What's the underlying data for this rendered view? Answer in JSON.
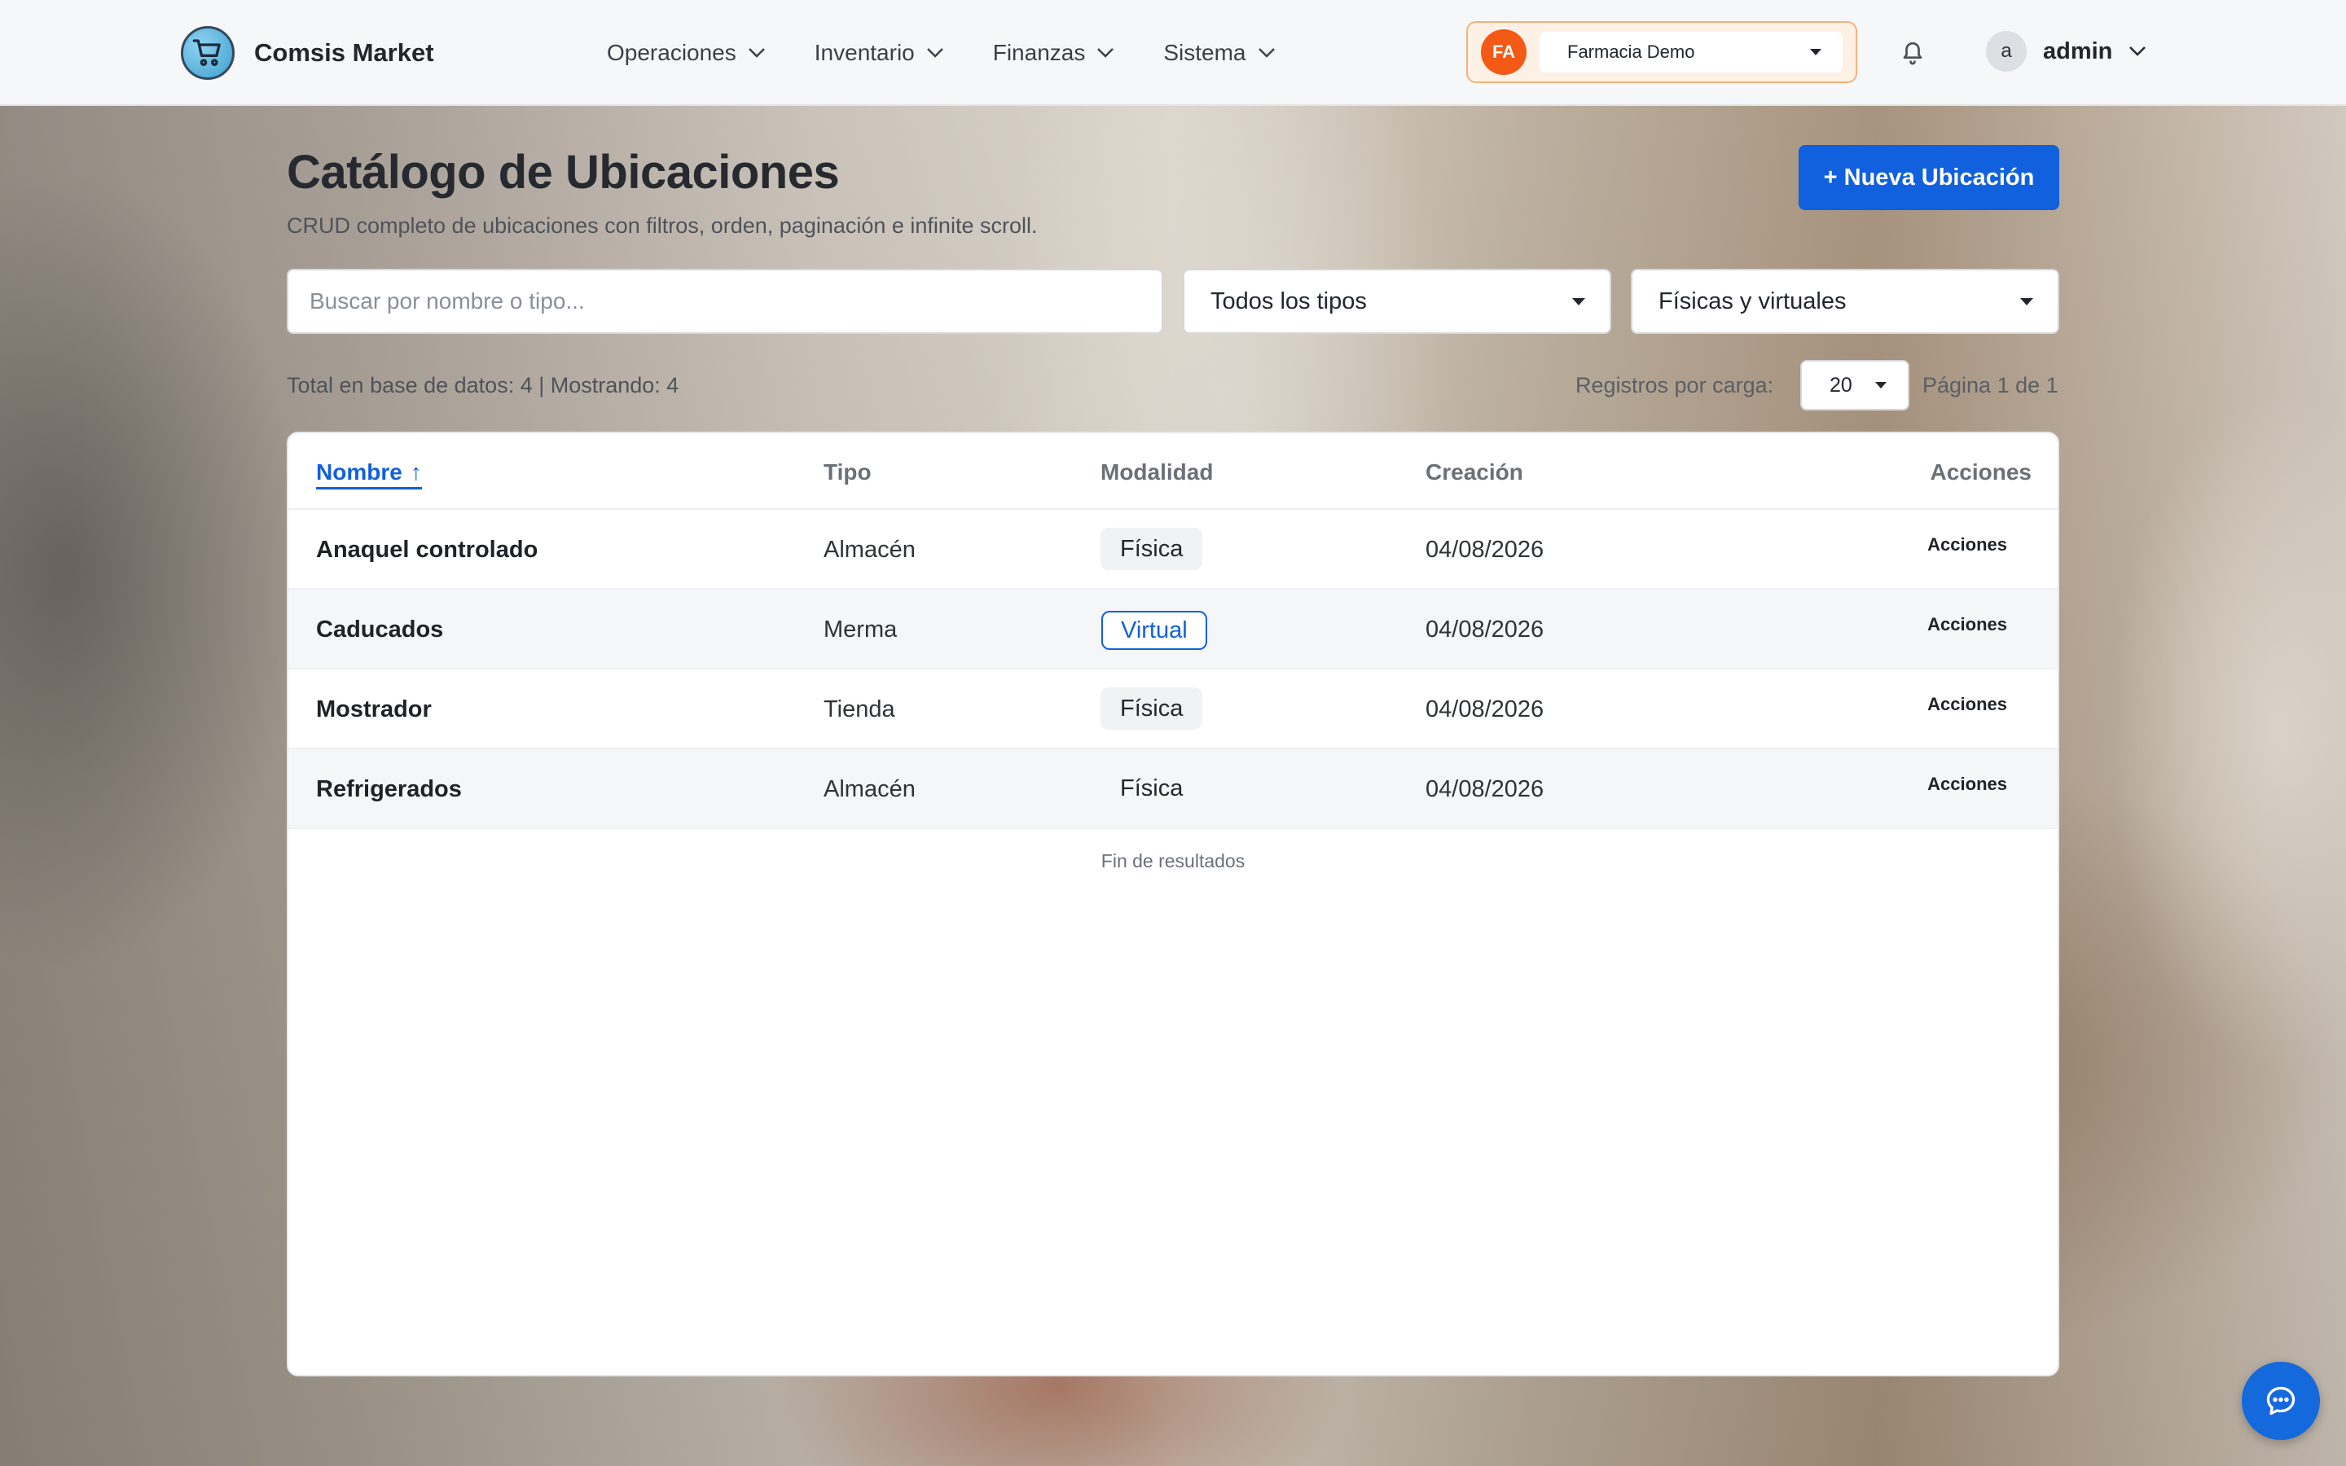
{
  "app": {
    "name": "Comsis Market",
    "logo_icon": "shopping-cart-icon"
  },
  "nav": {
    "items": [
      {
        "label": "Operaciones"
      },
      {
        "label": "Inventario"
      },
      {
        "label": "Finanzas"
      },
      {
        "label": "Sistema"
      }
    ]
  },
  "store": {
    "initials": "FA",
    "name": "Farmacia Demo",
    "accent": "#f25a15"
  },
  "user": {
    "initial": "a",
    "name": "admin"
  },
  "page": {
    "title": "Catálogo de Ubicaciones",
    "subtitle": "CRUD completo de ubicaciones con filtros, orden, paginación e infinite scroll.",
    "new_button": "+ Nueva Ubicación"
  },
  "filters": {
    "search_placeholder": "Buscar por nombre o tipo...",
    "search_value": "",
    "type_selected": "Todos los tipos",
    "mode_selected": "Físicas y virtuales"
  },
  "summary": {
    "totals": "Total en base de datos: 4 | Mostrando: 4",
    "per_load_label": "Registros por carga:",
    "per_load_value": "20",
    "page_info": "Página 1 de 1"
  },
  "table": {
    "headers": {
      "name": "Nombre",
      "sort_arrow": "↑",
      "type": "Tipo",
      "mode": "Modalidad",
      "created": "Creación",
      "actions": "Acciones"
    },
    "rows": [
      {
        "name": "Anaquel controlado",
        "type": "Almacén",
        "mode": "Física",
        "created": "04/08/2026",
        "action": "Acciones"
      },
      {
        "name": "Caducados",
        "type": "Merma",
        "mode": "Virtual",
        "created": "04/08/2026",
        "action": "Acciones"
      },
      {
        "name": "Mostrador",
        "type": "Tienda",
        "mode": "Física",
        "created": "04/08/2026",
        "action": "Acciones"
      },
      {
        "name": "Refrigerados",
        "type": "Almacén",
        "mode": "Física",
        "created": "04/08/2026",
        "action": "Acciones"
      }
    ],
    "end_text": "Fin de resultados"
  },
  "colors": {
    "primary": "#1160dd",
    "store_border": "#f3b27a"
  }
}
